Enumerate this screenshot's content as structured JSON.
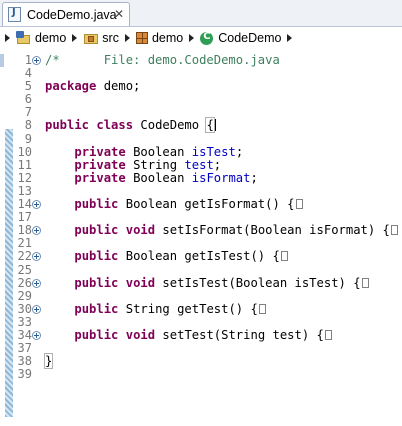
{
  "editor_tab": {
    "title": "CodeDemo.java",
    "close": "✕",
    "icon": "java-file-icon"
  },
  "breadcrumb": {
    "items": [
      {
        "label": "demo",
        "icon": "java-project-icon"
      },
      {
        "label": "src",
        "icon": "source-folder-icon"
      },
      {
        "label": "demo",
        "icon": "package-icon"
      },
      {
        "label": "CodeDemo",
        "icon": "class-icon"
      }
    ]
  },
  "colors": {
    "keyword": "#7f0055",
    "comment": "#3f7f5f",
    "field": "#0000c0",
    "line_number": "#787878"
  },
  "code_lines": [
    {
      "ln": "1",
      "fold": true,
      "tokens": [
        {
          "t": "/*      File: demo.CodeDemo.java",
          "c": "cm"
        }
      ]
    },
    {
      "ln": "4",
      "tokens": []
    },
    {
      "ln": "5",
      "tokens": [
        {
          "t": "package",
          "c": "kw"
        },
        {
          "t": " demo;"
        }
      ]
    },
    {
      "ln": "6",
      "tokens": []
    },
    {
      "ln": "7",
      "tokens": []
    },
    {
      "ln": "8",
      "tokens": [
        {
          "t": "public",
          "c": "kw"
        },
        {
          "t": " "
        },
        {
          "t": "class",
          "c": "kw"
        },
        {
          "t": " CodeDemo "
        },
        {
          "t": "{",
          "c": "hl"
        },
        {
          "caret": true
        }
      ]
    },
    {
      "ln": "9",
      "tokens": []
    },
    {
      "ln": "10",
      "tokens": [
        {
          "t": "    "
        },
        {
          "t": "private",
          "c": "kw"
        },
        {
          "t": " Boolean "
        },
        {
          "t": "isTest",
          "c": "fld"
        },
        {
          "t": ";"
        }
      ]
    },
    {
      "ln": "11",
      "tokens": [
        {
          "t": "    "
        },
        {
          "t": "private",
          "c": "kw"
        },
        {
          "t": " String "
        },
        {
          "t": "test",
          "c": "fld"
        },
        {
          "t": ";"
        }
      ]
    },
    {
      "ln": "12",
      "tokens": [
        {
          "t": "    "
        },
        {
          "t": "private",
          "c": "kw"
        },
        {
          "t": " Boolean "
        },
        {
          "t": "isFormat",
          "c": "fld"
        },
        {
          "t": ";"
        }
      ]
    },
    {
      "ln": "13",
      "tokens": []
    },
    {
      "ln": "14",
      "fold": true,
      "tokens": [
        {
          "t": "    "
        },
        {
          "t": "public",
          "c": "kw"
        },
        {
          "t": " Boolean getIsFormat() {"
        },
        {
          "box": true
        }
      ]
    },
    {
      "ln": "17",
      "tokens": []
    },
    {
      "ln": "18",
      "fold": true,
      "tokens": [
        {
          "t": "    "
        },
        {
          "t": "public",
          "c": "kw"
        },
        {
          "t": " "
        },
        {
          "t": "void",
          "c": "kw"
        },
        {
          "t": " setIsFormat(Boolean isFormat) {"
        },
        {
          "box": true
        }
      ]
    },
    {
      "ln": "21",
      "tokens": []
    },
    {
      "ln": "22",
      "fold": true,
      "tokens": [
        {
          "t": "    "
        },
        {
          "t": "public",
          "c": "kw"
        },
        {
          "t": " Boolean getIsTest() {"
        },
        {
          "box": true
        }
      ]
    },
    {
      "ln": "25",
      "tokens": []
    },
    {
      "ln": "26",
      "fold": true,
      "tokens": [
        {
          "t": "    "
        },
        {
          "t": "public",
          "c": "kw"
        },
        {
          "t": " "
        },
        {
          "t": "void",
          "c": "kw"
        },
        {
          "t": " setIsTest(Boolean isTest) {"
        },
        {
          "box": true
        }
      ]
    },
    {
      "ln": "29",
      "tokens": []
    },
    {
      "ln": "30",
      "fold": true,
      "tokens": [
        {
          "t": "    "
        },
        {
          "t": "public",
          "c": "kw"
        },
        {
          "t": " String getTest() {"
        },
        {
          "box": true
        }
      ]
    },
    {
      "ln": "33",
      "tokens": []
    },
    {
      "ln": "34",
      "fold": true,
      "tokens": [
        {
          "t": "    "
        },
        {
          "t": "public",
          "c": "kw"
        },
        {
          "t": " "
        },
        {
          "t": "void",
          "c": "kw"
        },
        {
          "t": " setTest(String test) {"
        },
        {
          "box": true
        }
      ]
    },
    {
      "ln": "37",
      "tokens": []
    },
    {
      "ln": "38",
      "tokens": [
        {
          "t": "}",
          "c": "hl"
        }
      ]
    },
    {
      "ln": "39",
      "tokens": []
    }
  ]
}
